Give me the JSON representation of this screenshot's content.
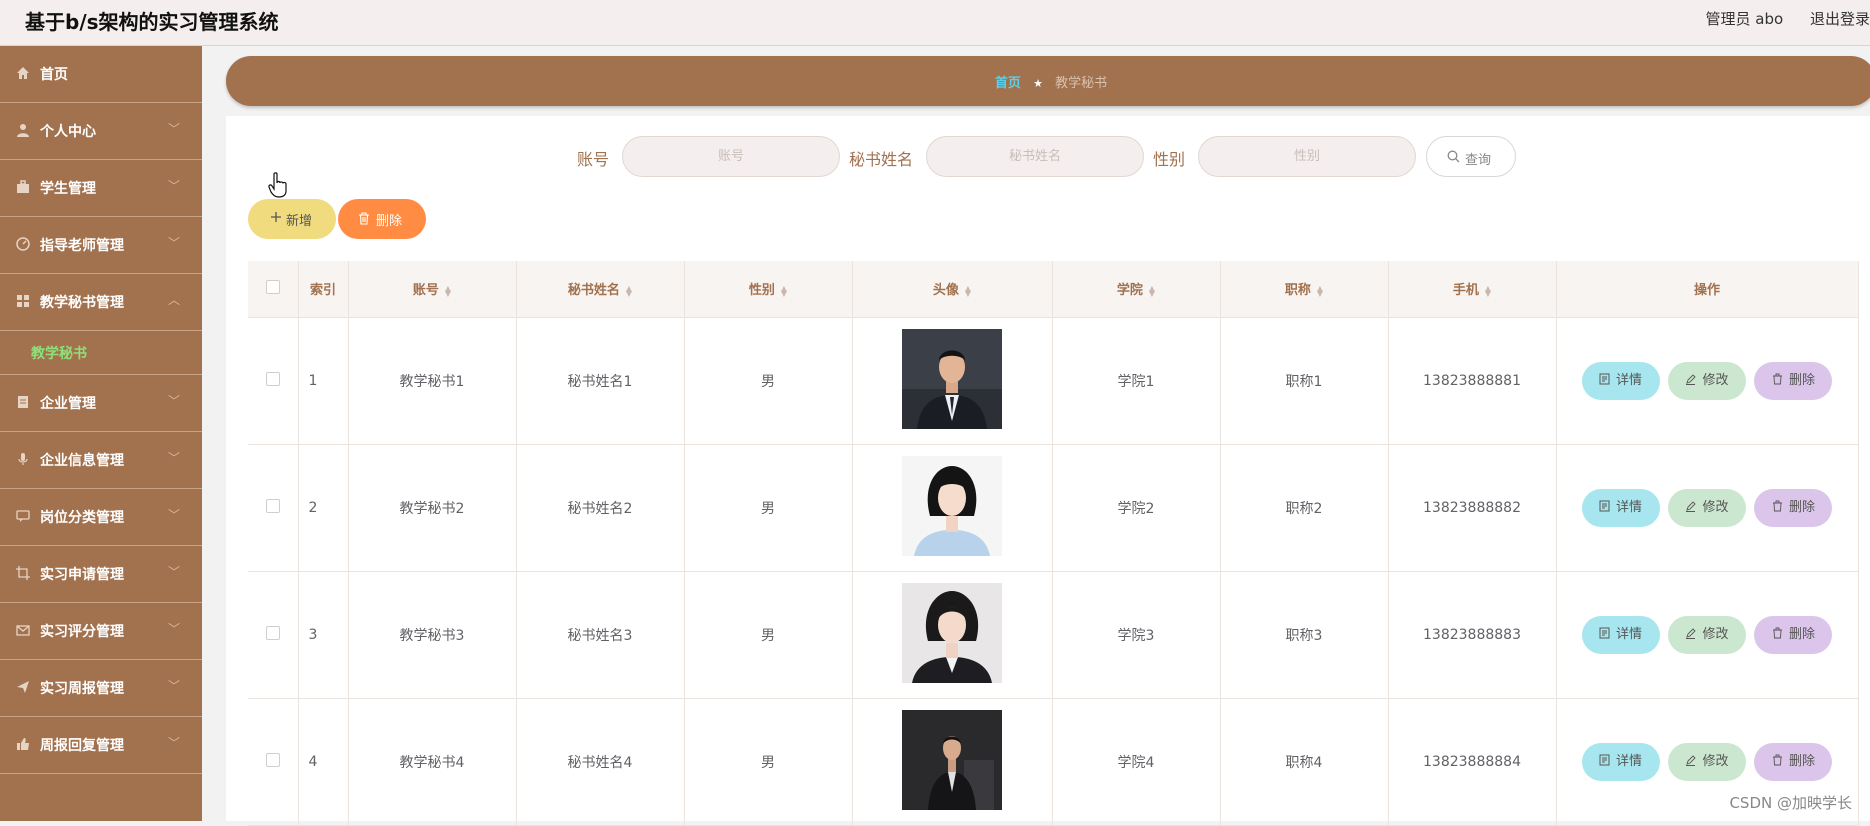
{
  "header": {
    "app_title": "基于b/s架构的实习管理系统",
    "user": "管理员 abo",
    "logout": "退出登录"
  },
  "sidebar": {
    "items": [
      {
        "label": "首页",
        "icon": "home-icon"
      },
      {
        "label": "个人中心",
        "icon": "user-icon"
      },
      {
        "label": "学生管理",
        "icon": "briefcase-icon"
      },
      {
        "label": "指导老师管理",
        "icon": "dashboard-icon"
      },
      {
        "label": "教学秘书管理",
        "icon": "grid-icon",
        "expanded": true
      },
      {
        "label": "企业管理",
        "icon": "document-icon"
      },
      {
        "label": "企业信息管理",
        "icon": "mic-icon"
      },
      {
        "label": "岗位分类管理",
        "icon": "chat-icon"
      },
      {
        "label": "实习申请管理",
        "icon": "crop-icon"
      },
      {
        "label": "实习评分管理",
        "icon": "mail-icon"
      },
      {
        "label": "实习周报管理",
        "icon": "send-icon"
      },
      {
        "label": "周报回复管理",
        "icon": "thumb-icon"
      }
    ],
    "active_sub": "教学秘书",
    "accent_color": "#a2714e"
  },
  "breadcrumb": {
    "home": "首页",
    "current": "教学秘书"
  },
  "search": {
    "account_label": "账号",
    "account_placeholder": "账号",
    "name_label": "秘书姓名",
    "name_placeholder": "秘书姓名",
    "gender_label": "性别",
    "gender_placeholder": "性别",
    "query_label": "查询"
  },
  "toolbar": {
    "add_label": "新增",
    "delete_label": "删除"
  },
  "table": {
    "headers": {
      "index": "索引",
      "account": "账号",
      "name": "秘书姓名",
      "gender": "性别",
      "avatar": "头像",
      "college": "学院",
      "title": "职称",
      "phone": "手机",
      "ops": "操作"
    },
    "rows": [
      {
        "index": "1",
        "account": "教学秘书1",
        "name": "秘书姓名1",
        "gender": "男",
        "college": "学院1",
        "title": "职称1",
        "phone": "13823888881",
        "avatar": "man-suit"
      },
      {
        "index": "2",
        "account": "教学秘书2",
        "name": "秘书姓名2",
        "gender": "男",
        "college": "学院2",
        "title": "职称2",
        "phone": "13823888882",
        "avatar": "woman-blue"
      },
      {
        "index": "3",
        "account": "教学秘书3",
        "name": "秘书姓名3",
        "gender": "男",
        "college": "学院3",
        "title": "职称3",
        "phone": "13823888883",
        "avatar": "woman-dark"
      },
      {
        "index": "4",
        "account": "教学秘书4",
        "name": "秘书姓名4",
        "gender": "男",
        "college": "学院4",
        "title": "职称4",
        "phone": "13823888884",
        "avatar": "man-dark"
      }
    ],
    "row_actions": {
      "detail": "详情",
      "edit": "修改",
      "delete": "删除"
    }
  },
  "watermark": "CSDN @加映学长"
}
